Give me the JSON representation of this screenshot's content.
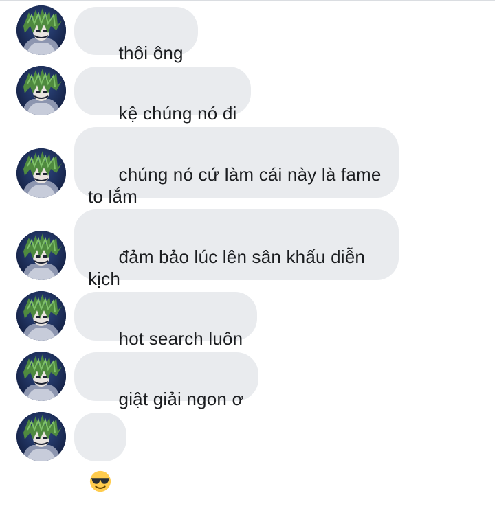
{
  "conversation": {
    "messages": [
      {
        "text": "thôi ông"
      },
      {
        "text": "kệ chúng nó đi"
      },
      {
        "text": "chúng nó cứ làm cái này là fame\nto lắm"
      },
      {
        "text": "đảm bảo lúc lên sân khấu diễn\nkịch"
      },
      {
        "text": "hot search luôn"
      },
      {
        "text": "giật giải ngon ơ"
      },
      {
        "emoji": "smiling-face-with-sunglasses"
      }
    ],
    "avatar_icon": "user-avatar"
  },
  "colors": {
    "bubble_bg": "#e9ebee",
    "text": "#1c1e21",
    "avatar_bg": "#1a2a52"
  }
}
